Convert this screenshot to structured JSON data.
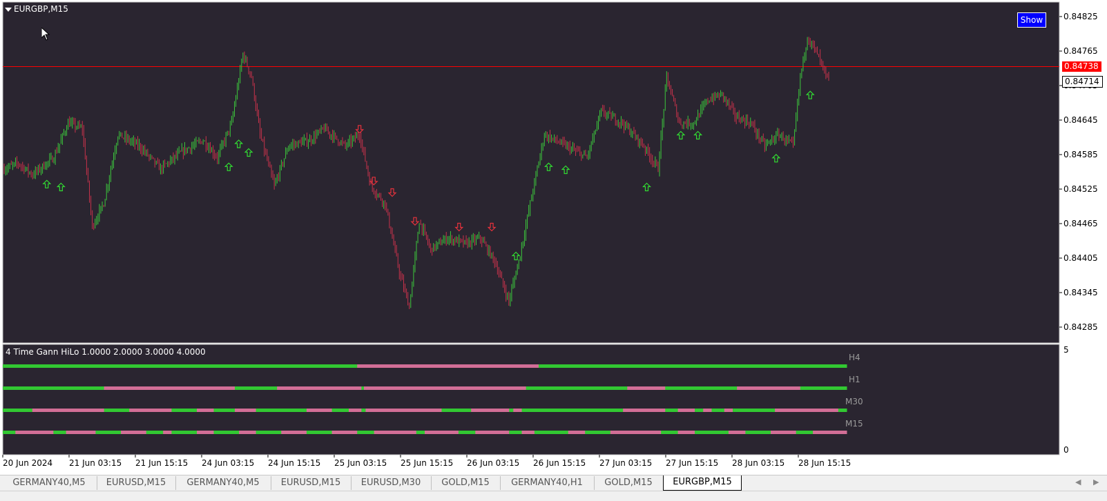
{
  "chart": {
    "title": "EURGBP,M15",
    "show_button": "Show",
    "current_price": "0.84738",
    "bid_price": "0.84714",
    "price_levels": [
      "0.84825",
      "0.84765",
      "0.84705",
      "0.84645",
      "0.84585",
      "0.84525",
      "0.84465",
      "0.84405",
      "0.84345",
      "0.84285"
    ],
    "time_labels": [
      "20 Jun 2024",
      "21 Jun 03:15",
      "21 Jun 15:15",
      "24 Jun 03:15",
      "24 Jun 15:15",
      "25 Jun 03:15",
      "25 Jun 15:15",
      "26 Jun 03:15",
      "26 Jun 15:15",
      "27 Jun 03:15",
      "27 Jun 15:15",
      "28 Jun 03:15",
      "28 Jun 15:15"
    ],
    "colors": {
      "background": "#2a2530",
      "bull": "#3cc83c",
      "bear": "#c8324b",
      "price_line": "#ff0000"
    }
  },
  "indicator": {
    "title": "4 Time Gann HiLo 1.0000 2.0000 3.0000 4.0000",
    "scale_top": "5",
    "scale_bottom": "0",
    "timeframes": [
      {
        "label": "H4",
        "segments": [
          [
            0,
            0.42,
            "g"
          ],
          [
            0.42,
            0.635,
            "p"
          ],
          [
            0.635,
            1,
            "g"
          ]
        ]
      },
      {
        "label": "H1",
        "segments": [
          [
            0,
            0.12,
            "g"
          ],
          [
            0.12,
            0.275,
            "p"
          ],
          [
            0.275,
            0.325,
            "g"
          ],
          [
            0.325,
            0.425,
            "p"
          ],
          [
            0.425,
            0.428,
            "g"
          ],
          [
            0.428,
            0.62,
            "p"
          ],
          [
            0.62,
            0.74,
            "g"
          ],
          [
            0.74,
            0.785,
            "p"
          ],
          [
            0.785,
            0.87,
            "g"
          ],
          [
            0.87,
            0.945,
            "p"
          ],
          [
            0.945,
            1,
            "g"
          ]
        ]
      },
      {
        "label": "M30",
        "segments": [
          [
            0,
            0.035,
            "g"
          ],
          [
            0.035,
            0.12,
            "p"
          ],
          [
            0.12,
            0.15,
            "g"
          ],
          [
            0.15,
            0.2,
            "p"
          ],
          [
            0.2,
            0.23,
            "g"
          ],
          [
            0.23,
            0.25,
            "p"
          ],
          [
            0.25,
            0.275,
            "g"
          ],
          [
            0.275,
            0.3,
            "p"
          ],
          [
            0.3,
            0.36,
            "g"
          ],
          [
            0.36,
            0.39,
            "p"
          ],
          [
            0.39,
            0.41,
            "g"
          ],
          [
            0.41,
            0.425,
            "p"
          ],
          [
            0.425,
            0.43,
            "g"
          ],
          [
            0.43,
            0.52,
            "p"
          ],
          [
            0.52,
            0.555,
            "g"
          ],
          [
            0.555,
            0.6,
            "p"
          ],
          [
            0.6,
            0.605,
            "g"
          ],
          [
            0.605,
            0.615,
            "p"
          ],
          [
            0.615,
            0.735,
            "g"
          ],
          [
            0.735,
            0.785,
            "p"
          ],
          [
            0.785,
            0.8,
            "g"
          ],
          [
            0.8,
            0.82,
            "p"
          ],
          [
            0.82,
            0.83,
            "g"
          ],
          [
            0.83,
            0.84,
            "p"
          ],
          [
            0.84,
            0.855,
            "g"
          ],
          [
            0.855,
            0.865,
            "p"
          ],
          [
            0.865,
            0.915,
            "g"
          ],
          [
            0.915,
            0.99,
            "p"
          ],
          [
            0.99,
            1,
            "g"
          ]
        ]
      },
      {
        "label": "M15",
        "segments": [
          [
            0,
            0.015,
            "g"
          ],
          [
            0.015,
            0.06,
            "p"
          ],
          [
            0.06,
            0.075,
            "g"
          ],
          [
            0.075,
            0.11,
            "p"
          ],
          [
            0.11,
            0.14,
            "g"
          ],
          [
            0.14,
            0.17,
            "p"
          ],
          [
            0.17,
            0.19,
            "g"
          ],
          [
            0.19,
            0.2,
            "p"
          ],
          [
            0.2,
            0.23,
            "g"
          ],
          [
            0.23,
            0.25,
            "p"
          ],
          [
            0.25,
            0.28,
            "g"
          ],
          [
            0.28,
            0.3,
            "p"
          ],
          [
            0.3,
            0.33,
            "g"
          ],
          [
            0.33,
            0.36,
            "p"
          ],
          [
            0.36,
            0.39,
            "g"
          ],
          [
            0.39,
            0.42,
            "p"
          ],
          [
            0.42,
            0.44,
            "g"
          ],
          [
            0.44,
            0.49,
            "p"
          ],
          [
            0.49,
            0.5,
            "g"
          ],
          [
            0.5,
            0.54,
            "p"
          ],
          [
            0.54,
            0.56,
            "g"
          ],
          [
            0.56,
            0.6,
            "p"
          ],
          [
            0.6,
            0.615,
            "g"
          ],
          [
            0.615,
            0.63,
            "p"
          ],
          [
            0.63,
            0.67,
            "g"
          ],
          [
            0.67,
            0.69,
            "p"
          ],
          [
            0.69,
            0.72,
            "g"
          ],
          [
            0.72,
            0.78,
            "p"
          ],
          [
            0.78,
            0.8,
            "g"
          ],
          [
            0.8,
            0.82,
            "p"
          ],
          [
            0.82,
            0.86,
            "g"
          ],
          [
            0.86,
            0.88,
            "p"
          ],
          [
            0.88,
            0.91,
            "g"
          ],
          [
            0.91,
            0.94,
            "p"
          ],
          [
            0.94,
            0.96,
            "g"
          ],
          [
            0.96,
            1,
            "p"
          ]
        ]
      }
    ],
    "colors": {
      "green": "#32c832",
      "pink": "#d26e96"
    }
  },
  "tabs": [
    {
      "label": "GERMANY40,M5",
      "active": false
    },
    {
      "label": "EURUSD,M15",
      "active": false
    },
    {
      "label": "GERMANY40,M5",
      "active": false
    },
    {
      "label": "EURUSD,M15",
      "active": false
    },
    {
      "label": "EURUSD,M30",
      "active": false
    },
    {
      "label": "GOLD,M15",
      "active": false
    },
    {
      "label": "GERMANY40,H1",
      "active": false
    },
    {
      "label": "GOLD,M15",
      "active": false
    },
    {
      "label": "EURGBP,M15",
      "active": true
    }
  ],
  "tab_nav": {
    "prev": "◀",
    "next": "▶"
  }
}
